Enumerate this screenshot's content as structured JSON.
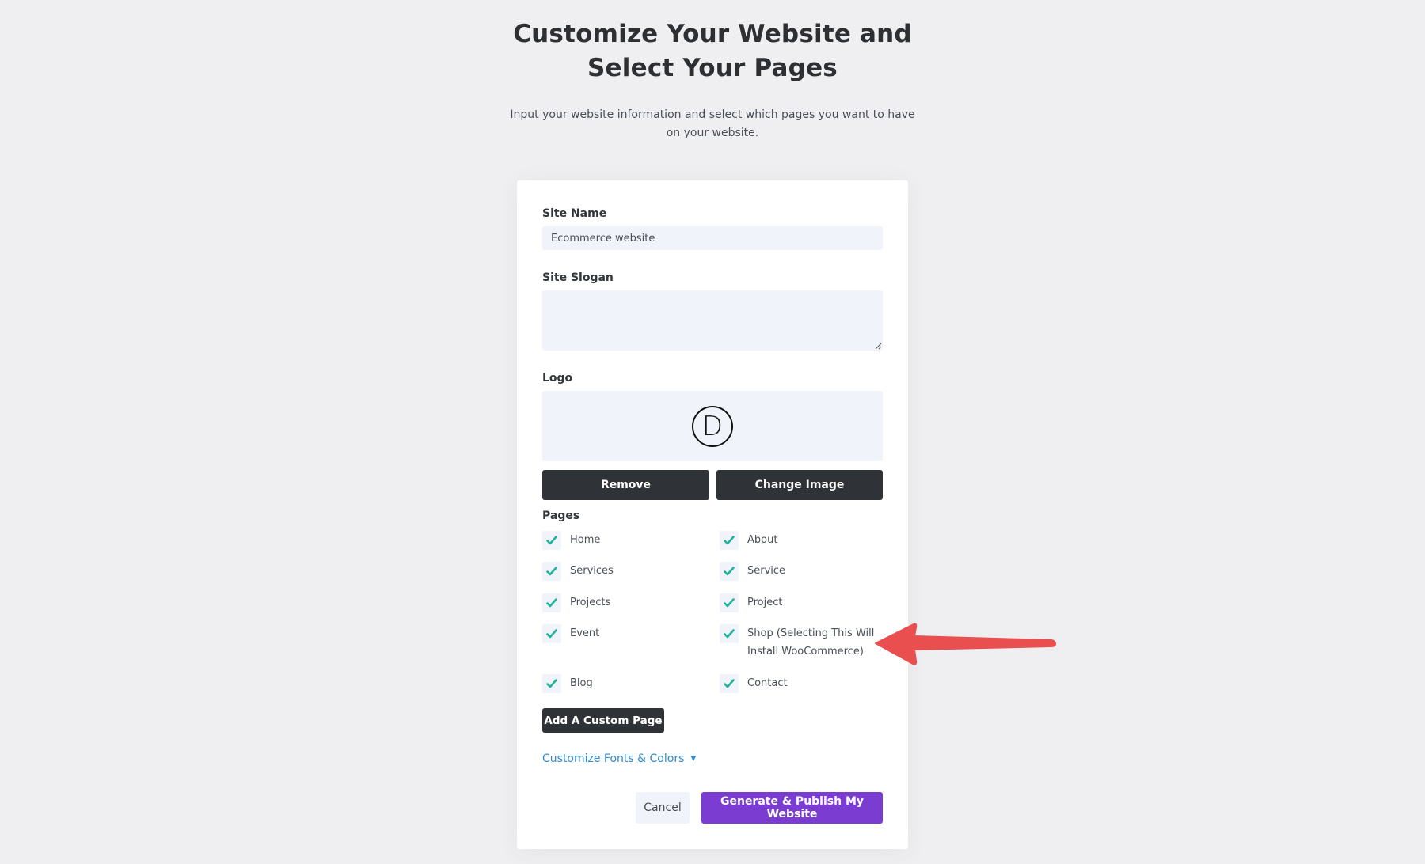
{
  "header": {
    "title_line1": "Customize Your Website and",
    "title_line2": "Select Your Pages",
    "subtitle_line1": "Input your website information and select which pages you want to have",
    "subtitle_line2": "on your website."
  },
  "form": {
    "site_name": {
      "label": "Site Name",
      "value": "Ecommerce website"
    },
    "site_slogan": {
      "label": "Site Slogan",
      "value": ""
    },
    "logo": {
      "label": "Logo",
      "glyph": "D",
      "icon": "divi-logo-icon",
      "remove_label": "Remove",
      "change_label": "Change Image"
    },
    "pages": {
      "label": "Pages",
      "check_color": "#1fb39a",
      "items": [
        {
          "label": "Home",
          "checked": true
        },
        {
          "label": "About",
          "checked": true
        },
        {
          "label": "Services",
          "checked": true
        },
        {
          "label": "Service",
          "checked": true
        },
        {
          "label": "Projects",
          "checked": true
        },
        {
          "label": "Project",
          "checked": true
        },
        {
          "label": "Event",
          "checked": true
        },
        {
          "label": "Shop (Selecting This Will Install WooCommerce)",
          "checked": true
        },
        {
          "label": "Blog",
          "checked": true
        },
        {
          "label": "Contact",
          "checked": true
        }
      ]
    },
    "add_custom_page_label": "Add A Custom Page",
    "customize_fonts_label": "Customize Fonts & Colors",
    "customize_caret": "▼",
    "cancel_label": "Cancel",
    "publish_label": "Generate & Publish My Website"
  },
  "colors": {
    "background": "#efeff1",
    "dark_button": "#2f3338",
    "primary": "#7b3dd1",
    "link": "#2e8ad1",
    "checkmark": "#1fb39a",
    "annotation_arrow": "#ea4f4f"
  },
  "annotation": {
    "icon": "red-arrow-pointing-left"
  }
}
